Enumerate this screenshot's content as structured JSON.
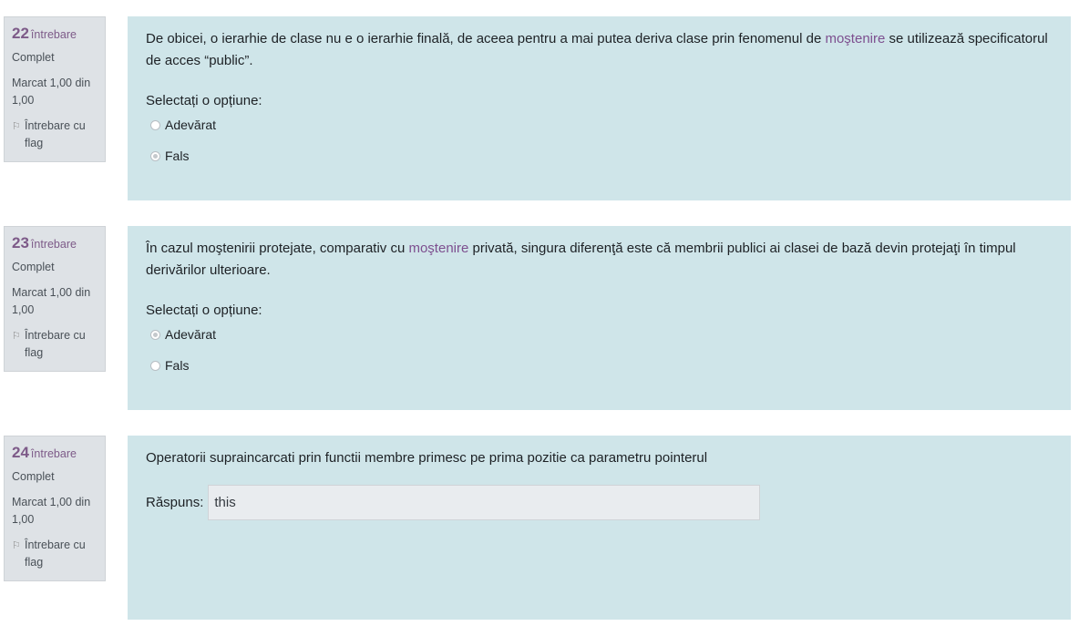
{
  "questions": [
    {
      "number": "22",
      "word": "întrebare",
      "state": "Complet",
      "grade": "Marcat 1,00 din 1,00",
      "flag": "Întrebare cu flag",
      "text_before": "De obicei, o ierarhie de clase nu e o ierarhie finală, de aceea pentru a mai putea deriva clase prin fenomenul de ",
      "link": "moştenire",
      "text_after": " se utilizează specificatorul de acces “public”.",
      "prompt": "Selectați o opțiune:",
      "options": [
        {
          "label": "Adevărat",
          "checked": false
        },
        {
          "label": "Fals",
          "checked": true
        }
      ]
    },
    {
      "number": "23",
      "word": "întrebare",
      "state": "Complet",
      "grade": "Marcat 1,00 din 1,00",
      "flag": "Întrebare cu flag",
      "text_before": "În cazul moştenirii protejate, comparativ cu ",
      "link": "moştenire",
      "text_after": " privată, singura diferenţă este că membrii publici ai clasei de bază devin protejaţi în timpul derivărilor ulterioare.",
      "prompt": "Selectați o opțiune:",
      "options": [
        {
          "label": "Adevărat",
          "checked": true
        },
        {
          "label": "Fals",
          "checked": false
        }
      ]
    },
    {
      "number": "24",
      "word": "întrebare",
      "state": "Complet",
      "grade": "Marcat 1,00 din 1,00",
      "flag": "Întrebare cu flag",
      "text": "Operatorii supraincarcati prin functii membre primesc pe prima pozitie ca parametru pointerul",
      "answer_label": "Răspuns:",
      "answer_value": "this"
    }
  ],
  "colors": {
    "content_bg": "#cfe5e9",
    "info_bg": "#dee2e6",
    "accent": "#7d5a88"
  }
}
